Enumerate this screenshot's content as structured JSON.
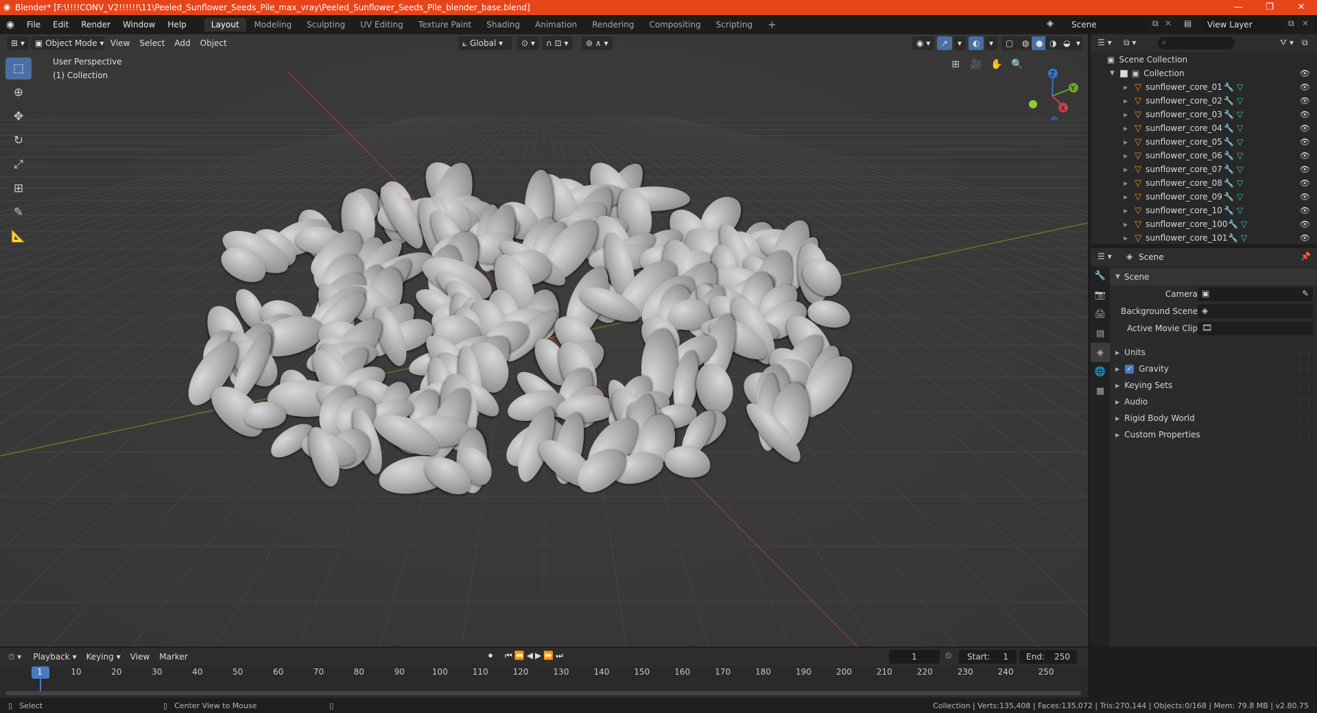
{
  "titlebar": {
    "title": "Blender* [F:\\!!!!CONV_V2!!!!!!\\11\\Peeled_Sunflower_Seeds_Pile_max_vray\\Peeled_Sunflower_Seeds_Pile_blender_base.blend]",
    "minimize": "—",
    "restore": "❐",
    "close": "✕"
  },
  "menubar": {
    "menus": [
      "File",
      "Edit",
      "Render",
      "Window",
      "Help"
    ],
    "workspaces": [
      "Layout",
      "Modeling",
      "Sculpting",
      "UV Editing",
      "Texture Paint",
      "Shading",
      "Animation",
      "Rendering",
      "Compositing",
      "Scripting"
    ],
    "active_workspace": "Layout",
    "add_workspace": "+",
    "scene_label": "Scene",
    "view_layer_label": "View Layer"
  },
  "viewport": {
    "mode": "Object Mode",
    "menus": [
      "View",
      "Select",
      "Add",
      "Object"
    ],
    "transform_orientation": "Global",
    "overlay_text_line1": "User Perspective",
    "overlay_text_line2": "(1) Collection",
    "gizmo": {
      "x": "X",
      "y": "Y",
      "z": "Z"
    }
  },
  "outliner": {
    "search_placeholder": "",
    "root": "Scene Collection",
    "collection": "Collection",
    "objects": [
      "sunflower_core_01",
      "sunflower_core_02",
      "sunflower_core_03",
      "sunflower_core_04",
      "sunflower_core_05",
      "sunflower_core_06",
      "sunflower_core_07",
      "sunflower_core_08",
      "sunflower_core_09",
      "sunflower_core_10",
      "sunflower_core_100",
      "sunflower_core_101"
    ]
  },
  "properties": {
    "context_label": "Scene",
    "panel_title": "Scene",
    "camera_label": "Camera",
    "background_scene_label": "Background Scene",
    "active_movie_clip_label": "Active Movie Clip",
    "sections": [
      "Units",
      "Gravity",
      "Keying Sets",
      "Audio",
      "Rigid Body World",
      "Custom Properties"
    ],
    "gravity_checked": true
  },
  "timeline": {
    "menus": [
      "Playback",
      "Keying",
      "View",
      "Marker"
    ],
    "current_frame": "1",
    "start_label": "Start:",
    "start_value": "1",
    "end_label": "End:",
    "end_value": "250",
    "ticks": [
      "1",
      "10",
      "20",
      "30",
      "40",
      "50",
      "60",
      "70",
      "80",
      "90",
      "100",
      "110",
      "120",
      "130",
      "140",
      "150",
      "160",
      "170",
      "180",
      "190",
      "200",
      "210",
      "220",
      "230",
      "240",
      "250"
    ]
  },
  "statusbar": {
    "left_action": "Select",
    "middle_action": "Center View to Mouse",
    "stats": "Collection | Verts:135,408 | Faces:135,072 | Tris:270,144 | Objects:0/168 | Mem: 79.8 MB | v2.80.75"
  },
  "colors": {
    "titlebar": "#e8441a",
    "accent_blue": "#4a6fa5",
    "axis_red": "#c8424f",
    "axis_green": "#6d9a2c",
    "object_orange": "#e8912a",
    "mesh_teal": "#3fc9b0"
  }
}
